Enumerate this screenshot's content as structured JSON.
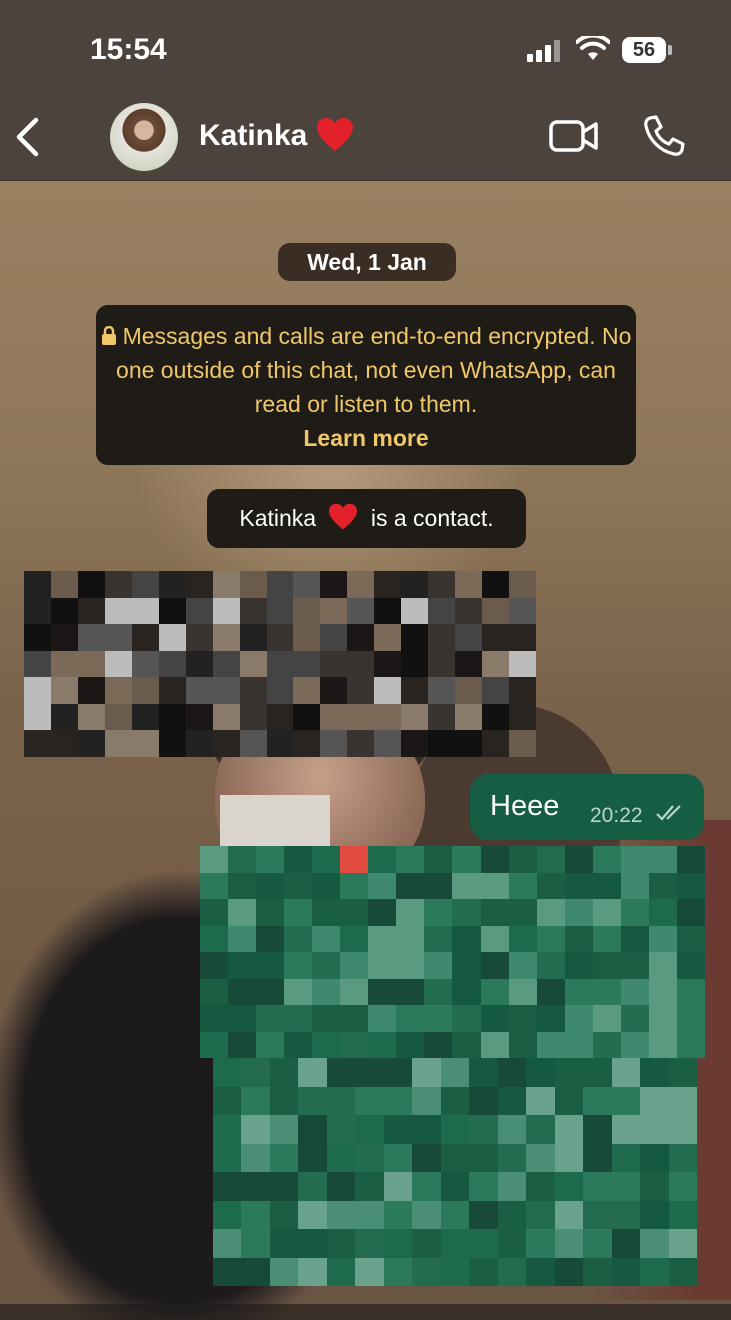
{
  "status_bar": {
    "time": "15:54",
    "battery": "56"
  },
  "chat_header": {
    "contact_name": "Katinka",
    "back_icon": "chevron-left-icon",
    "video_icon": "video-camera-icon",
    "call_icon": "phone-icon"
  },
  "system": {
    "date_label": "Wed, 1 Jan",
    "encryption_notice": "Messages and calls are end-to-end encrypted. No one outside of this chat, not even WhatsApp, can read or listen to them.",
    "learn_more": "Learn more",
    "contact_notice_name": "Katinka",
    "contact_notice_suffix": "is a contact."
  },
  "messages": [
    {
      "direction": "outgoing",
      "text": "Heee",
      "time": "20:22",
      "status": "read"
    }
  ],
  "colors": {
    "header": "#4c433d",
    "outgoing_bubble": "#155e44",
    "notice_text": "#f0c86a",
    "heart": "#e2212b"
  }
}
